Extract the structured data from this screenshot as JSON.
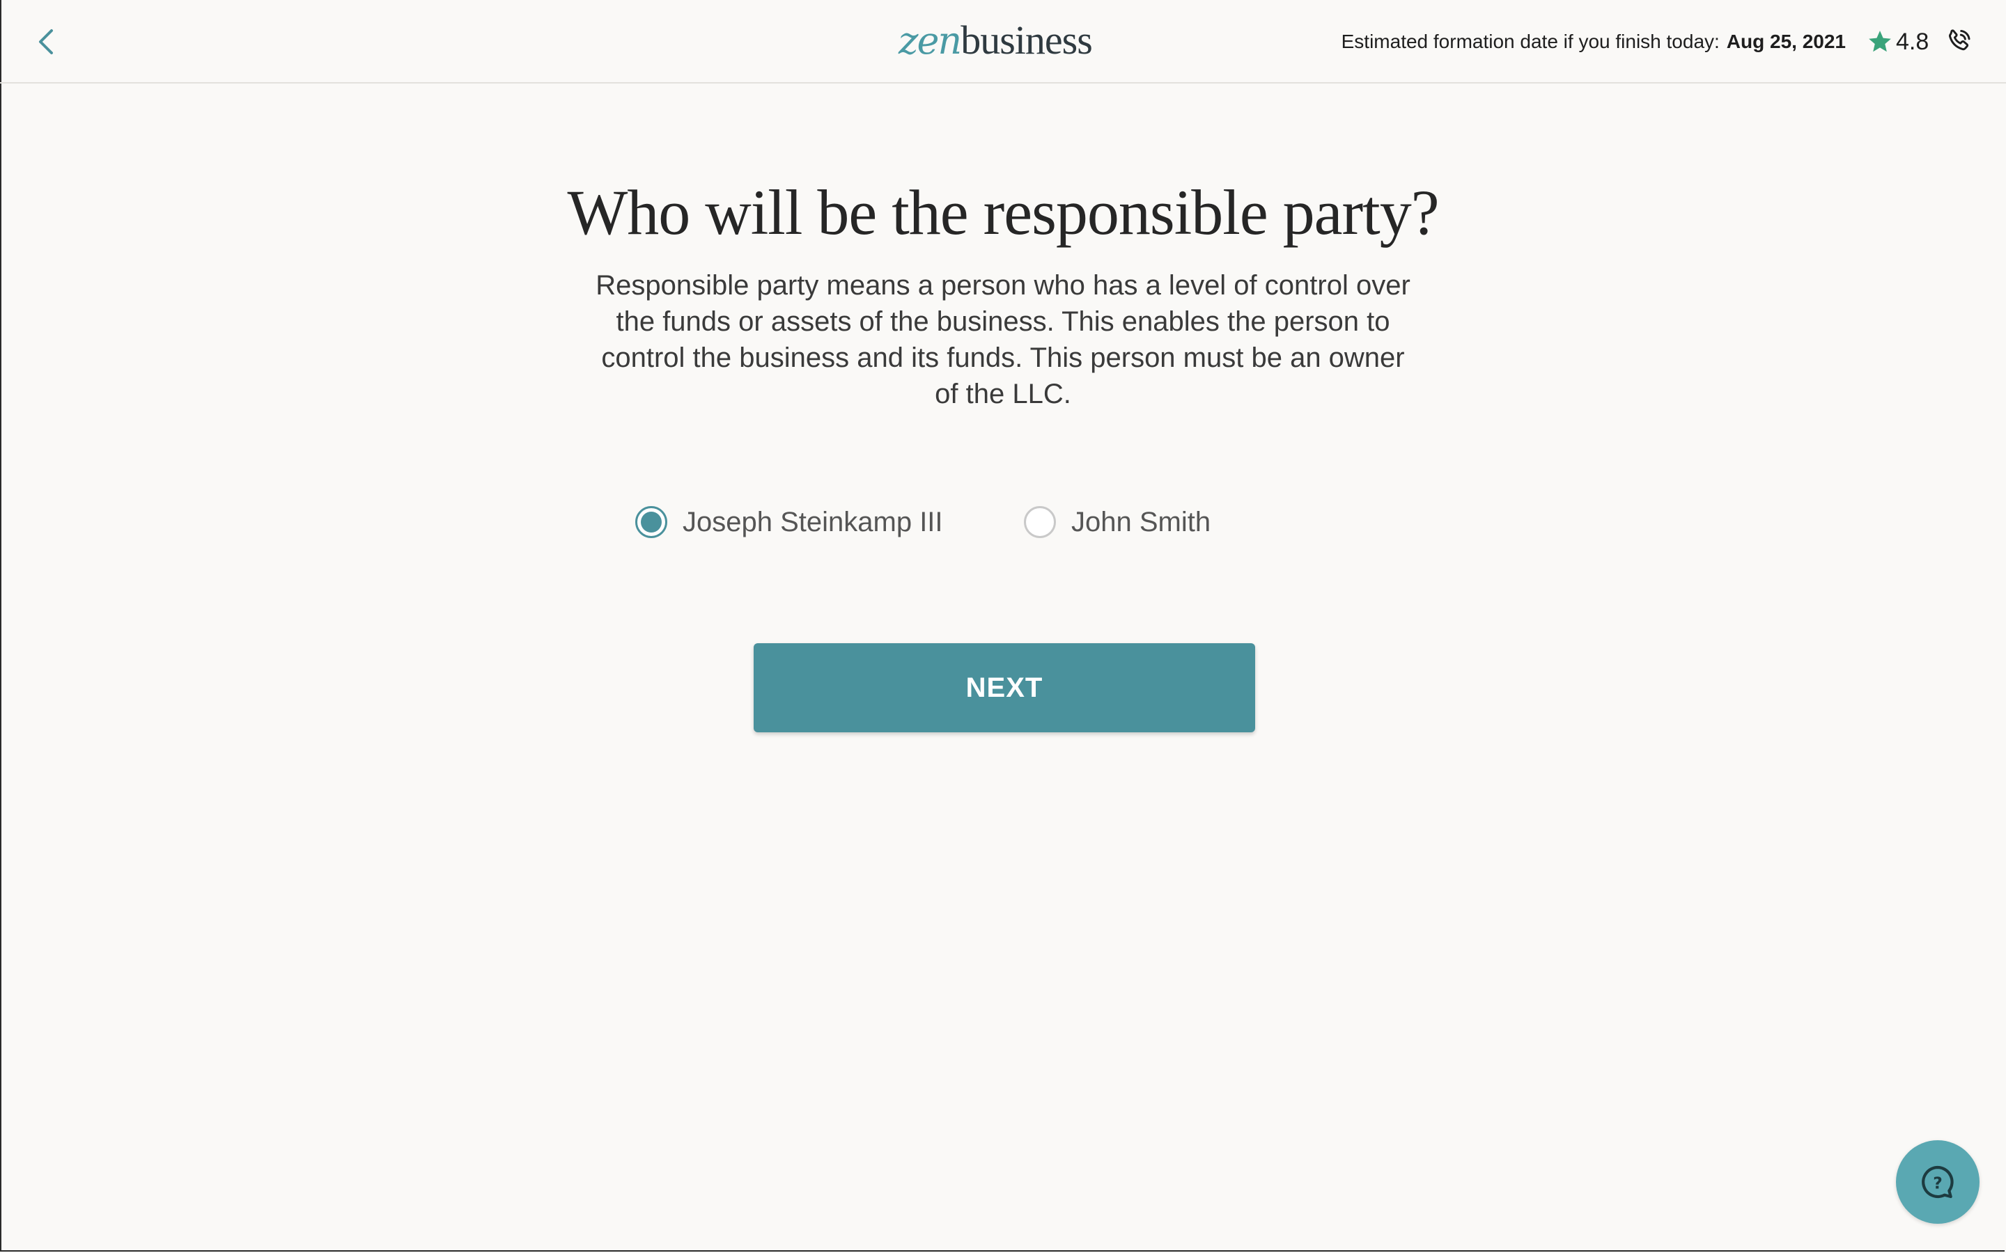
{
  "header": {
    "logo": {
      "part1": "zen",
      "part2": "business"
    },
    "estimate_label": "Estimated formation date if you finish today:",
    "estimate_date": "Aug 25, 2021",
    "rating": "4.8",
    "icons": {
      "back": "chevron-left-icon",
      "star": "star-icon",
      "phone": "phone-icon"
    }
  },
  "main": {
    "title": "Who will be the responsible party?",
    "description": "Responsible party means a person who has a level of control over the funds or assets of the business. This enables the person to control the business and its funds. This person must be an owner of the LLC.",
    "options": [
      {
        "label": "Joseph Steinkamp III",
        "selected": true
      },
      {
        "label": "John Smith",
        "selected": false
      }
    ],
    "next_label": "NEXT"
  },
  "help": {
    "icon": "help-chat-icon",
    "glyph": "?"
  },
  "colors": {
    "accent": "#4a919c",
    "logo_teal": "#4a9aa4",
    "star_green": "#3aa37a",
    "help_bubble": "#5aa8b2",
    "background": "#faf9f7"
  }
}
